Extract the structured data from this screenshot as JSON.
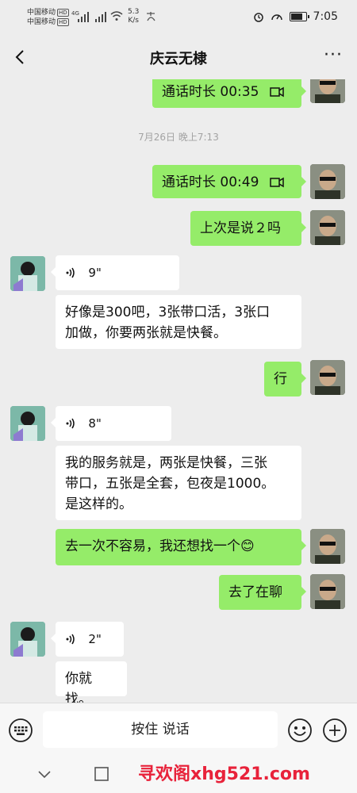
{
  "status_bar": {
    "carrier1": "中国移动",
    "carrier2": "中国移动",
    "hd": "HD",
    "net_type": "4G",
    "net_speed_value": "5.3",
    "net_speed_unit": "K/s",
    "time": "7:05"
  },
  "header": {
    "title": "庆云无棣",
    "more": "···"
  },
  "chat": {
    "messages": [
      {
        "side": "me",
        "kind": "call",
        "text": "通话时长 00:35"
      },
      {
        "side": "time",
        "text": "7月26日 晚上7:13"
      },
      {
        "side": "me",
        "kind": "call",
        "text": "通话时长 00:49"
      },
      {
        "side": "me",
        "kind": "text",
        "text": "上次是说２吗"
      },
      {
        "side": "other",
        "kind": "voice",
        "text": "9\""
      },
      {
        "side": "other",
        "kind": "text",
        "line1": "好像是300吧，3张带口活，3张口",
        "line2": "加做，你要两张就是快餐。"
      },
      {
        "side": "me",
        "kind": "text",
        "text": "行"
      },
      {
        "side": "other",
        "kind": "voice",
        "text": "8\""
      },
      {
        "side": "other",
        "kind": "text",
        "line1": "我的服务就是，两张是快餐，三张",
        "line2": "带口，五张是全套，包夜是1000。",
        "line3": "是这样的。"
      },
      {
        "side": "me",
        "kind": "text",
        "text": "去一次不容易，我还想找一个😊"
      },
      {
        "side": "me",
        "kind": "text",
        "text": "去了在聊"
      },
      {
        "side": "other",
        "kind": "voice",
        "text": "2\""
      },
      {
        "side": "other",
        "kind": "text",
        "text": "你就找。"
      }
    ]
  },
  "input_bar": {
    "hold_to_talk": "按住 说话"
  },
  "watermark": "寻欢阁xhg521.com",
  "colors": {
    "my_bubble": "#95ec69",
    "other_bubble": "#ffffff",
    "background": "#ededed",
    "watermark": "#e8223a"
  },
  "icons": [
    "back-icon",
    "more-icon",
    "call-icon",
    "voice-icon",
    "keyboard-voice-icon",
    "emoji-icon",
    "plus-icon",
    "nav-back-icon",
    "nav-home-icon"
  ]
}
